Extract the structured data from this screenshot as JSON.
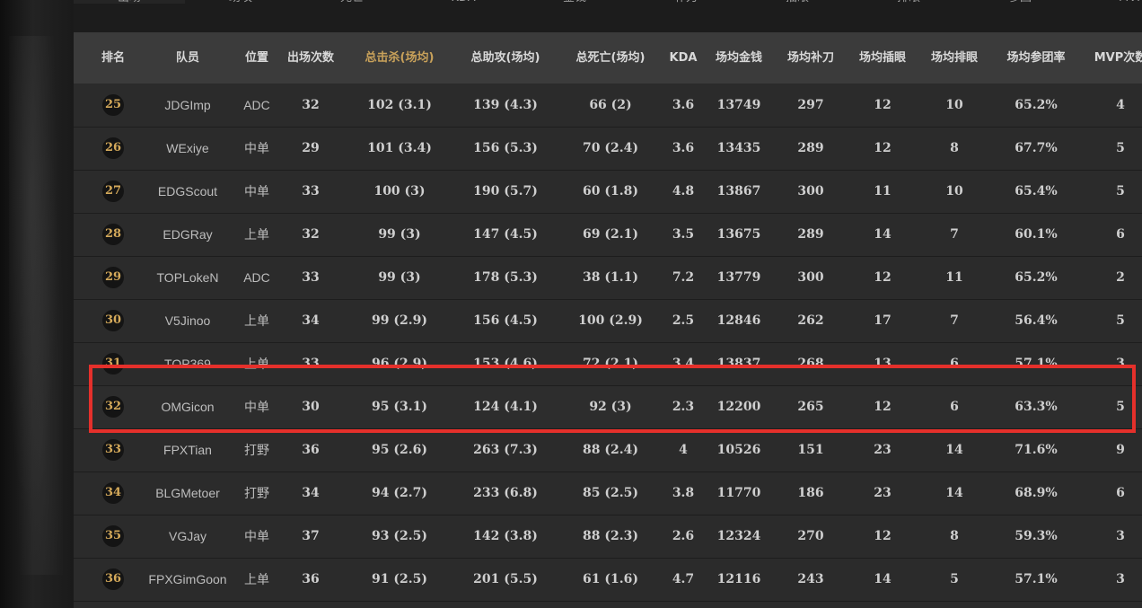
{
  "top_tabs": [
    "出场",
    "助攻",
    "死亡",
    "KDA",
    "金钱",
    "补刀",
    "插眼",
    "排眼",
    "参团",
    "MVP"
  ],
  "columns": [
    "排名",
    "队员",
    "位置",
    "出场次数",
    "总击杀(场均)",
    "总助攻(场均)",
    "总死亡(场均)",
    "KDA",
    "场均金钱",
    "场均补刀",
    "场均插眼",
    "场均排眼",
    "场均参团率",
    "MVP次数"
  ],
  "sorted_column": "总击杀(场均)",
  "highlight_color": "#e5302b",
  "rank_color": "#d4a95a",
  "rows": [
    {
      "rank": "25",
      "player": "JDGImp",
      "position": "ADC",
      "games": "32",
      "kills": "102 (3.1)",
      "assists": "139 (4.3)",
      "deaths": "66 (2)",
      "kda": "3.6",
      "gold": "13749",
      "cs": "297",
      "wards": "12",
      "ward_clear": "10",
      "kp": "65.2%",
      "mvp": "4"
    },
    {
      "rank": "26",
      "player": "WExiye",
      "position": "中单",
      "games": "29",
      "kills": "101 (3.4)",
      "assists": "156 (5.3)",
      "deaths": "70 (2.4)",
      "kda": "3.6",
      "gold": "13435",
      "cs": "289",
      "wards": "12",
      "ward_clear": "8",
      "kp": "67.7%",
      "mvp": "5"
    },
    {
      "rank": "27",
      "player": "EDGScout",
      "position": "中单",
      "games": "33",
      "kills": "100 (3)",
      "assists": "190 (5.7)",
      "deaths": "60 (1.8)",
      "kda": "4.8",
      "gold": "13867",
      "cs": "300",
      "wards": "11",
      "ward_clear": "10",
      "kp": "65.4%",
      "mvp": "5"
    },
    {
      "rank": "28",
      "player": "EDGRay",
      "position": "上单",
      "games": "32",
      "kills": "99 (3)",
      "assists": "147 (4.5)",
      "deaths": "69 (2.1)",
      "kda": "3.5",
      "gold": "13675",
      "cs": "289",
      "wards": "14",
      "ward_clear": "7",
      "kp": "60.1%",
      "mvp": "6"
    },
    {
      "rank": "29",
      "player": "TOPLokeN",
      "position": "ADC",
      "games": "33",
      "kills": "99 (3)",
      "assists": "178 (5.3)",
      "deaths": "38 (1.1)",
      "kda": "7.2",
      "gold": "13779",
      "cs": "300",
      "wards": "12",
      "ward_clear": "11",
      "kp": "65.2%",
      "mvp": "2"
    },
    {
      "rank": "30",
      "player": "V5Jinoo",
      "position": "上单",
      "games": "34",
      "kills": "99 (2.9)",
      "assists": "156 (4.5)",
      "deaths": "100 (2.9)",
      "kda": "2.5",
      "gold": "12846",
      "cs": "262",
      "wards": "17",
      "ward_clear": "7",
      "kp": "56.4%",
      "mvp": "5"
    },
    {
      "rank": "31",
      "player": "TOP369",
      "position": "上单",
      "games": "33",
      "kills": "96 (2.9)",
      "assists": "153 (4.6)",
      "deaths": "72 (2.1)",
      "kda": "3.4",
      "gold": "13837",
      "cs": "268",
      "wards": "13",
      "ward_clear": "6",
      "kp": "57.1%",
      "mvp": "3"
    },
    {
      "rank": "32",
      "player": "OMGicon",
      "position": "中单",
      "games": "30",
      "kills": "95 (3.1)",
      "assists": "124 (4.1)",
      "deaths": "92 (3)",
      "kda": "2.3",
      "gold": "12200",
      "cs": "265",
      "wards": "12",
      "ward_clear": "6",
      "kp": "63.3%",
      "mvp": "5"
    },
    {
      "rank": "33",
      "player": "FPXTian",
      "position": "打野",
      "games": "36",
      "kills": "95 (2.6)",
      "assists": "263 (7.3)",
      "deaths": "88 (2.4)",
      "kda": "4",
      "gold": "10526",
      "cs": "151",
      "wards": "23",
      "ward_clear": "14",
      "kp": "71.6%",
      "mvp": "9"
    },
    {
      "rank": "34",
      "player": "BLGMetoer",
      "position": "打野",
      "games": "34",
      "kills": "94 (2.7)",
      "assists": "233 (6.8)",
      "deaths": "85 (2.5)",
      "kda": "3.8",
      "gold": "11770",
      "cs": "186",
      "wards": "23",
      "ward_clear": "14",
      "kp": "68.9%",
      "mvp": "6"
    },
    {
      "rank": "35",
      "player": "VGJay",
      "position": "中单",
      "games": "37",
      "kills": "93 (2.5)",
      "assists": "142 (3.8)",
      "deaths": "88 (2.3)",
      "kda": "2.6",
      "gold": "12324",
      "cs": "270",
      "wards": "12",
      "ward_clear": "8",
      "kp": "59.3%",
      "mvp": "3"
    },
    {
      "rank": "36",
      "player": "FPXGimGoon",
      "position": "上单",
      "games": "36",
      "kills": "91 (2.5)",
      "assists": "201 (5.5)",
      "deaths": "61 (1.6)",
      "kda": "4.7",
      "gold": "12116",
      "cs": "243",
      "wards": "14",
      "ward_clear": "5",
      "kp": "57.1%",
      "mvp": "3"
    }
  ],
  "highlighted_player": "OMGicon"
}
